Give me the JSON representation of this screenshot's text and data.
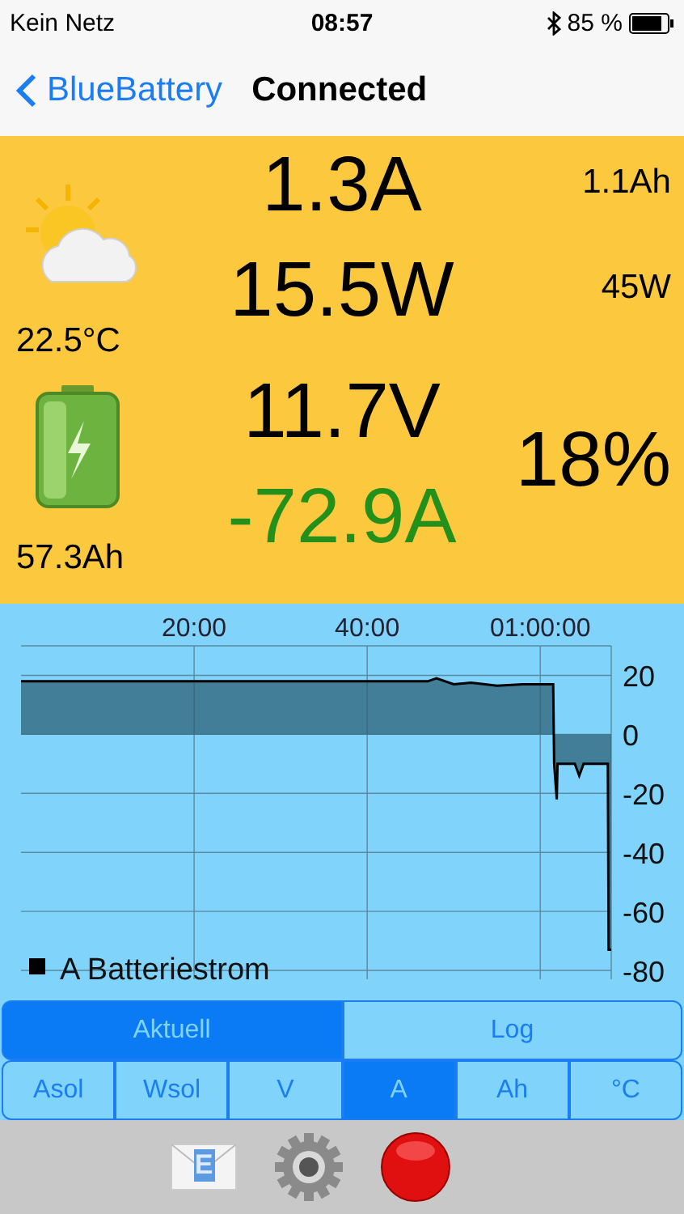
{
  "status_bar": {
    "carrier": "Kein Netz",
    "time": "08:57",
    "battery_percent": "85 %"
  },
  "nav": {
    "back_label": "BlueBattery",
    "title": "Connected"
  },
  "readings": {
    "solar_current": "1.3A",
    "solar_charge": "1.1Ah",
    "solar_power": "15.5W",
    "solar_power_2": "45W",
    "temperature": "22.5°C",
    "voltage": "11.7V",
    "battery_current": "-72.9A",
    "state_of_charge": "18%",
    "capacity": "57.3Ah"
  },
  "chart": {
    "chart_data": {
      "type": "area",
      "grid": true,
      "xlim": [
        0,
        68.2
      ],
      "ylim": [
        -83,
        30
      ],
      "xticks": [
        {
          "value": 20,
          "label": "20:00"
        },
        {
          "value": 40,
          "label": "40:00"
        },
        {
          "value": 60,
          "label": "01:00:00"
        }
      ],
      "yticks": [
        20,
        0,
        -20,
        -40,
        -60,
        -80
      ],
      "x": [
        0,
        47,
        48,
        50,
        52,
        55,
        58,
        61.5,
        61.6,
        61.9,
        62,
        64,
        64.5,
        65,
        67.8,
        67.9
      ],
      "series": [
        {
          "name": "A Batteriestrom",
          "color": "#000000",
          "values": [
            18,
            18,
            19,
            17,
            17.5,
            16.5,
            17,
            17,
            -10,
            -22,
            -10,
            -10,
            -14,
            -10,
            -10,
            -73
          ]
        }
      ]
    }
  },
  "view_tabs": [
    {
      "label": "Aktuell",
      "selected": true
    },
    {
      "label": "Log",
      "selected": false
    }
  ],
  "unit_tabs": [
    {
      "label": "Asol",
      "selected": false
    },
    {
      "label": "Wsol",
      "selected": false
    },
    {
      "label": "V",
      "selected": false
    },
    {
      "label": "A",
      "selected": true
    },
    {
      "label": "Ah",
      "selected": false
    },
    {
      "label": "°C",
      "selected": false
    }
  ],
  "toolbar": {
    "email_letter": "E"
  }
}
